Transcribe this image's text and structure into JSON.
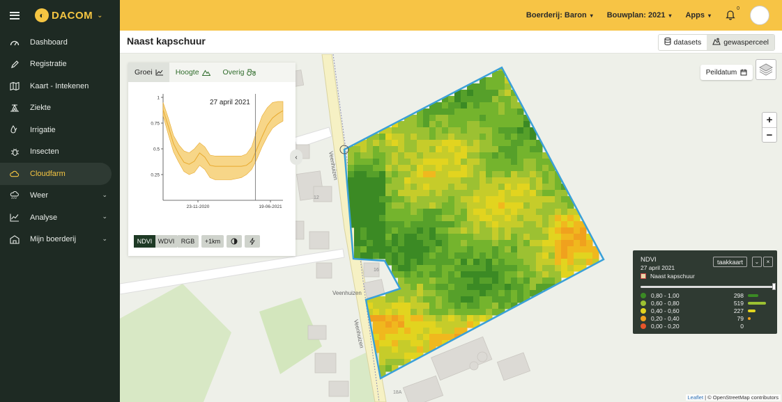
{
  "app": {
    "brand": "DACOM"
  },
  "sidebar": {
    "items": [
      {
        "label": "Dashboard",
        "icon": "gauge-icon",
        "active": false,
        "has_children": false
      },
      {
        "label": "Registratie",
        "icon": "pencil-icon",
        "active": false,
        "has_children": false
      },
      {
        "label": "Kaart - Intekenen",
        "icon": "map-icon",
        "active": false,
        "has_children": false
      },
      {
        "label": "Ziekte",
        "icon": "tent-icon",
        "active": false,
        "has_children": false
      },
      {
        "label": "Irrigatie",
        "icon": "drops-icon",
        "active": false,
        "has_children": false
      },
      {
        "label": "Insecten",
        "icon": "bug-icon",
        "active": false,
        "has_children": false
      },
      {
        "label": "Cloudfarm",
        "icon": "cloud-sun-icon",
        "active": true,
        "has_children": false
      },
      {
        "label": "Weer",
        "icon": "weather-icon",
        "active": false,
        "has_children": true
      },
      {
        "label": "Analyse",
        "icon": "line-chart-icon",
        "active": false,
        "has_children": true
      },
      {
        "label": "Mijn boerderij",
        "icon": "farm-icon",
        "active": false,
        "has_children": true
      }
    ]
  },
  "topbar": {
    "farm": "Boerderij: Baron",
    "plan": "Bouwplan: 2021",
    "apps": "Apps",
    "notifications": "0"
  },
  "page": {
    "title": "Naast kapschuur",
    "view_tabs": [
      {
        "label": "datasets",
        "icon": "database-icon",
        "active": false
      },
      {
        "label": "gewasperceel",
        "icon": "crop-icon",
        "active": true
      }
    ]
  },
  "chart_panel": {
    "tabs": [
      {
        "label": "Groei",
        "icon": "growth-chart-icon",
        "active": true
      },
      {
        "label": "Hoogte",
        "icon": "mountain-icon",
        "active": false
      },
      {
        "label": "Overig",
        "icon": "tractor-icon",
        "active": false
      }
    ],
    "date_label": "27 april 2021",
    "buttons": {
      "ndvi": "NDVI",
      "wdvi": "WDVI",
      "rgb": "RGB",
      "radius": "+1km"
    }
  },
  "chart_data": {
    "type": "area",
    "x_ticks": [
      "23-11-2020",
      "19-06-2021"
    ],
    "ylim": [
      0,
      1
    ],
    "y_ticks": [
      "0.25",
      "0.5",
      "0.75",
      "1"
    ],
    "marker_date": "27 april 2021",
    "series": [
      {
        "values": [
          0.88,
          0.72,
          0.55,
          0.45,
          0.37,
          0.35,
          0.38,
          0.46,
          0.42,
          0.34,
          0.33,
          0.33,
          0.33,
          0.33,
          0.33,
          0.33,
          0.34,
          0.38,
          0.5,
          0.62,
          0.73,
          0.8,
          0.84,
          0.87
        ],
        "upper": [
          0.95,
          0.8,
          0.63,
          0.54,
          0.48,
          0.46,
          0.5,
          0.56,
          0.52,
          0.44,
          0.43,
          0.43,
          0.43,
          0.43,
          0.43,
          0.43,
          0.45,
          0.52,
          0.68,
          0.82,
          0.9,
          0.95,
          0.96,
          0.96
        ],
        "lower": [
          0.82,
          0.64,
          0.47,
          0.37,
          0.28,
          0.25,
          0.27,
          0.34,
          0.3,
          0.22,
          0.2,
          0.2,
          0.2,
          0.2,
          0.21,
          0.22,
          0.25,
          0.3,
          0.4,
          0.52,
          0.62,
          0.7,
          0.74,
          0.77
        ]
      }
    ],
    "colors": {
      "band": "#f5cc6a",
      "line": "#e8a92e"
    }
  },
  "map": {
    "labels": [
      "Veenhuizen",
      "Veenhuizen",
      "Veenhuizen",
      "12",
      "16",
      "18A"
    ],
    "peildatum": "Peildatum",
    "attribution_link": "Leaflet",
    "attribution_text": "| © OpenStreetMap contributors",
    "colors": {
      "field_border": "#3aa0d8",
      "road": "#f6f1c4",
      "building": "#d9d7d2",
      "green": "#cfe4b6"
    }
  },
  "legend": {
    "title": "NDVI",
    "date": "27 april 2021",
    "field": "Naast kapschuur",
    "taakkaart": "taakkaart",
    "slider_fraction": 1.0,
    "classes": [
      {
        "range": "0,80 - 1,00",
        "count": "298",
        "color": "#3b8a24"
      },
      {
        "range": "0,60 - 0,80",
        "count": "519",
        "color": "#9cc132"
      },
      {
        "range": "0,40 - 0,60",
        "count": "227",
        "color": "#e2d41f"
      },
      {
        "range": "0,20 - 0,40",
        "count": "79",
        "color": "#f0a11e"
      },
      {
        "range": "0,00 - 0,20",
        "count": "0",
        "color": "#e8552a"
      }
    ]
  }
}
